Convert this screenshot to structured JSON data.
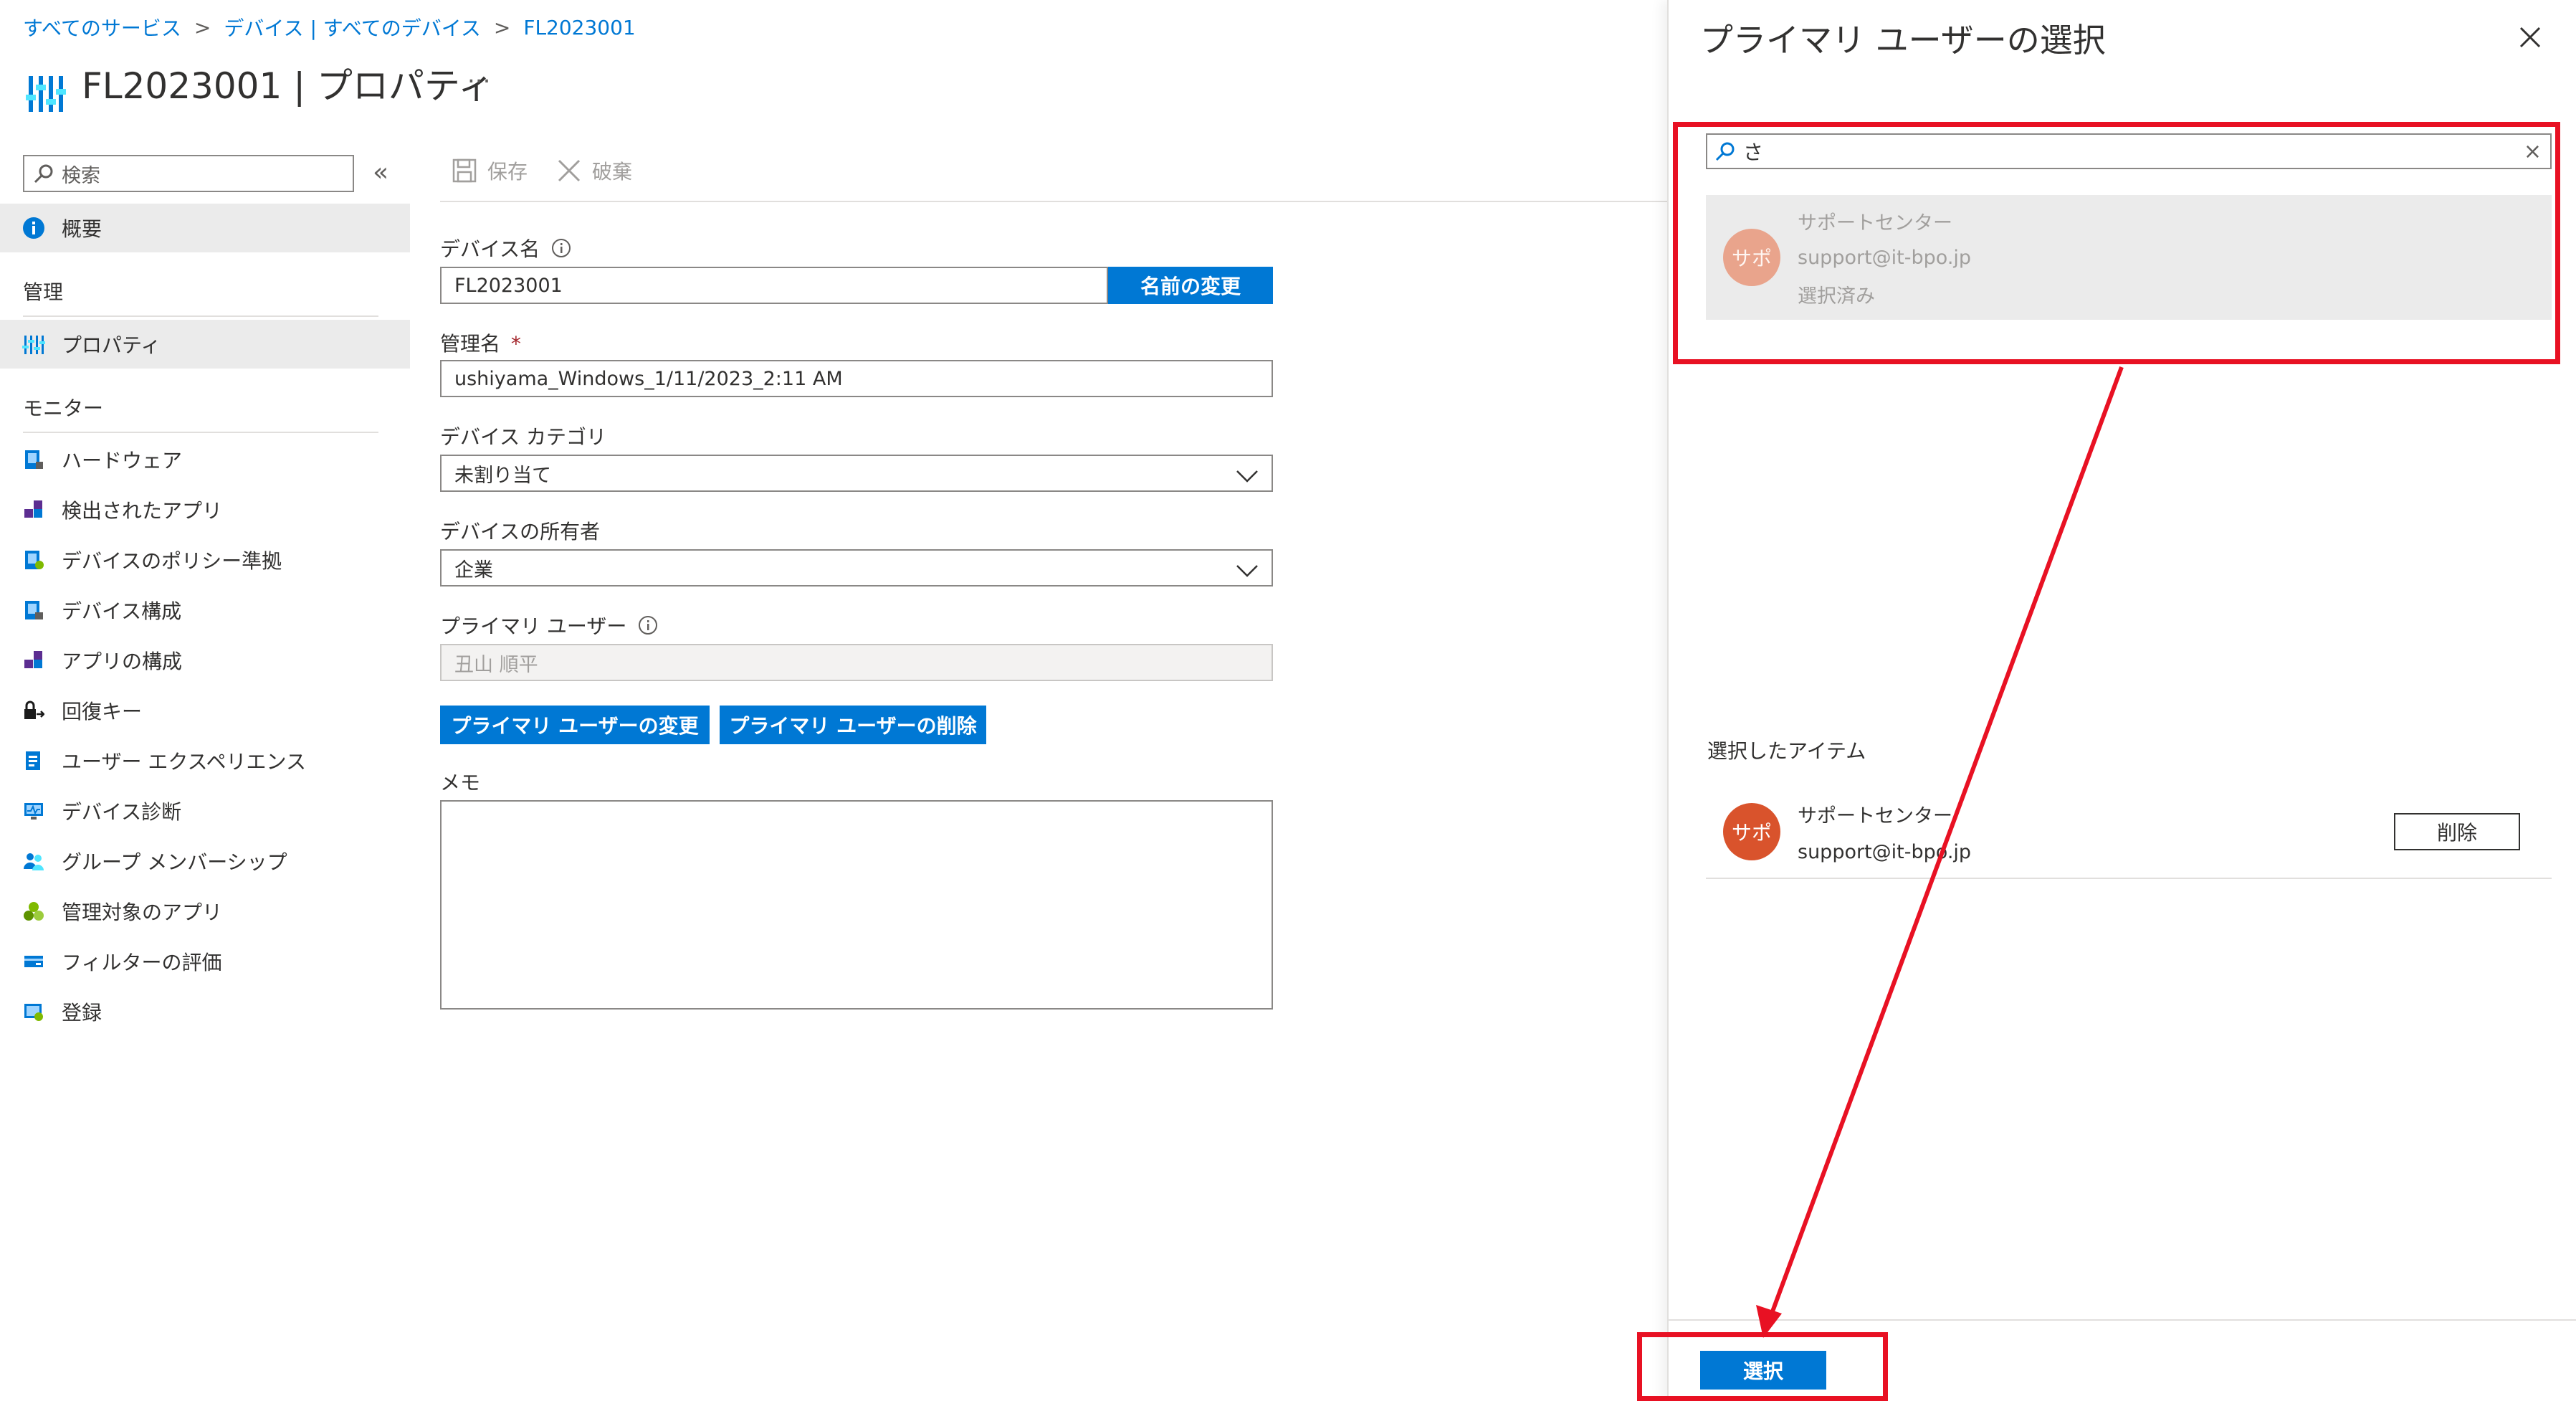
{
  "breadcrumb": {
    "items": [
      "すべてのサービス",
      "デバイス | すべてのデバイス",
      "FL2023001"
    ],
    "separator": ">"
  },
  "page": {
    "title": "FL2023001 | プロパティ",
    "more": "..."
  },
  "sidebar": {
    "search_placeholder": "検索",
    "collapse": "«",
    "overview": "概要",
    "manage_heading": "管理",
    "properties": "プロパティ",
    "monitor_heading": "モニター",
    "monitor_items": [
      {
        "label": "ハードウェア",
        "icon": "hardware-icon",
        "color": "#0078d4"
      },
      {
        "label": "検出されたアプリ",
        "icon": "apps-icon",
        "color": "#5c2d91"
      },
      {
        "label": "デバイスのポリシー準拠",
        "icon": "policy-icon",
        "color": "#0078d4"
      },
      {
        "label": "デバイス構成",
        "icon": "config-icon",
        "color": "#0078d4"
      },
      {
        "label": "アプリの構成",
        "icon": "app-config-icon",
        "color": "#5c2d91"
      },
      {
        "label": "回復キー",
        "icon": "key-icon",
        "color": "#000000"
      },
      {
        "label": "ユーザー エクスペリエンス",
        "icon": "experience-icon",
        "color": "#0078d4"
      },
      {
        "label": "デバイス診断",
        "icon": "diagnostics-icon",
        "color": "#0078d4"
      },
      {
        "label": "グループ メンバーシップ",
        "icon": "group-icon",
        "color": "#0078d4"
      },
      {
        "label": "管理対象のアプリ",
        "icon": "managed-apps-icon",
        "color": "#7fba00"
      },
      {
        "label": "フィルターの評価",
        "icon": "filter-icon",
        "color": "#0078d4"
      },
      {
        "label": "登録",
        "icon": "enroll-icon",
        "color": "#0078d4"
      }
    ]
  },
  "toolbar": {
    "save": "保存",
    "discard": "破棄"
  },
  "form": {
    "device_name_label": "デバイス名",
    "device_name_value": "FL2023001",
    "rename_button": "名前の変更",
    "mgmt_name_label": "管理名",
    "required_mark": "*",
    "mgmt_name_value": "ushiyama_Windows_1/11/2023_2:11 AM",
    "category_label": "デバイス カテゴリ",
    "category_value": "未割り当て",
    "owner_label": "デバイスの所有者",
    "owner_value": "企業",
    "primary_user_label": "プライマリ ユーザー",
    "primary_user_value": "丑山 順平",
    "change_user_button": "プライマリ ユーザーの変更",
    "delete_user_button": "プライマリ ユーザーの削除",
    "memo_label": "メモ",
    "memo_value": ""
  },
  "panel": {
    "title": "プライマリ ユーザーの選択",
    "close": "×",
    "search_value": "さ",
    "clear": "×",
    "result": {
      "avatar": "サポ",
      "name": "サポートセンター",
      "email": "support@it-bpo.jp",
      "status": "選択済み"
    },
    "selected_heading": "選択したアイテム",
    "selected": {
      "avatar": "サポ",
      "name": "サポートセンター",
      "email": "support@it-bpo.jp",
      "remove": "削除"
    },
    "select_button": "選択"
  },
  "colors": {
    "accent": "#0078d4",
    "avatar": "#d9532c",
    "highlight": "#e81123"
  }
}
